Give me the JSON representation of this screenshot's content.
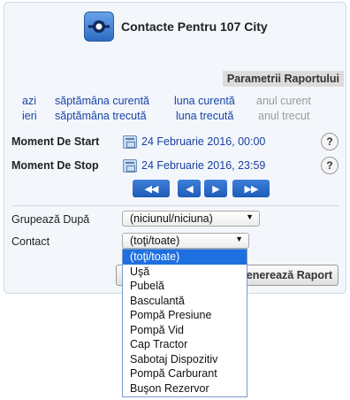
{
  "header": {
    "title": "Contacte Pentru 107 City",
    "logo_icon": "route-target-icon"
  },
  "params_label": "Parametrii Raportului",
  "periods": {
    "today": "azi",
    "this_week": "săptămâna curentă",
    "this_month": "luna curentă",
    "this_year": "anul curent",
    "yesterday": "ieri",
    "last_week": "săptămâna trecută",
    "last_month": "luna trecută",
    "last_year": "anul trecut"
  },
  "start": {
    "label": "Moment De Start",
    "value": "24 Februarie 2016, 00:00",
    "help": "?"
  },
  "stop": {
    "label": "Moment De Stop",
    "value": "24 Februarie 2016, 23:59",
    "help": "?"
  },
  "nav": {
    "first": "◀◀",
    "prev": "◀",
    "next": "▶",
    "last": "▶▶"
  },
  "group_by": {
    "label": "Grupează După",
    "value": "(niciunul/niciuna)"
  },
  "contact": {
    "label": "Contact",
    "value": "(toţi/toate)",
    "options": [
      "(toţi/toate)",
      "Uşă",
      "Pubelă",
      "Basculantă",
      "Pompă Presiune",
      "Pompă Vid",
      "Cap Tractor",
      "Sabotaj Dispozitiv",
      "Pompă Carburant",
      "Buşon Rezervor"
    ]
  },
  "generate_button": "Generează Raport",
  "colors": {
    "link": "#1a44a8",
    "accent": "#1e6fe0",
    "panel_bg": "#f3f7fc"
  }
}
